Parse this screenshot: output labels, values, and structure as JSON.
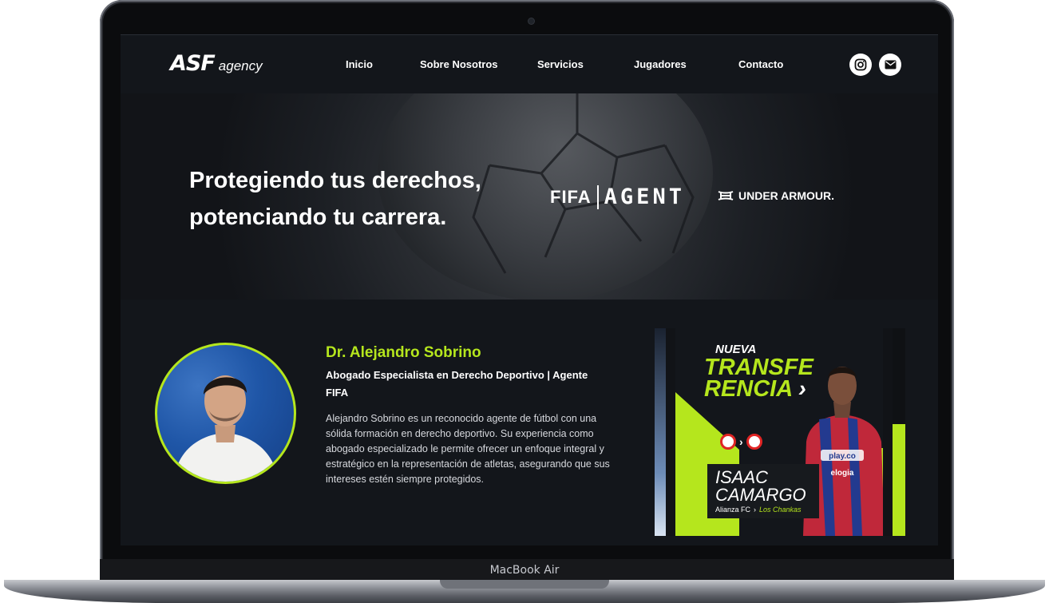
{
  "device": {
    "label": "MacBook Air"
  },
  "nav": {
    "logo_mark": "ASF",
    "logo_text": "agency",
    "links": [
      "Inicio",
      "Sobre Nosotros",
      "Servicios",
      "Jugadores",
      "Contacto"
    ],
    "social_icons": [
      "instagram-icon",
      "email-icon"
    ]
  },
  "hero": {
    "title_line1": "Protegiendo tus derechos,",
    "title_line2": "potenciando tu carrera.",
    "partner1_left": "FIFA",
    "partner1_right": "AGENT",
    "partner2": "UNDER ARMOUR."
  },
  "about": {
    "name": "Dr. Alejandro Sobrino",
    "role": "Abogado Especialista en Derecho Deportivo | Agente FIFA",
    "bio": "Alejandro Sobrino es un reconocido agente de fútbol con una sólida formación en derecho deportivo. Su experiencia como abogado especializado le permite ofrecer un enfoque integral y estratégico en la representación de atletas, asegurando que sus intereses estén siempre protegidos."
  },
  "slide": {
    "kicker": "NUEVA",
    "headline_line1": "TRANSFE",
    "headline_line2": "RENCIA",
    "player_first": "ISAAC",
    "player_last": "CAMARGO",
    "from_club": "Alianza FC",
    "to_club": "Los Chankas",
    "sponsor": "play.co",
    "sponsor2": "elogia"
  },
  "colors": {
    "accent": "#b5e61d",
    "background": "#13161b"
  }
}
